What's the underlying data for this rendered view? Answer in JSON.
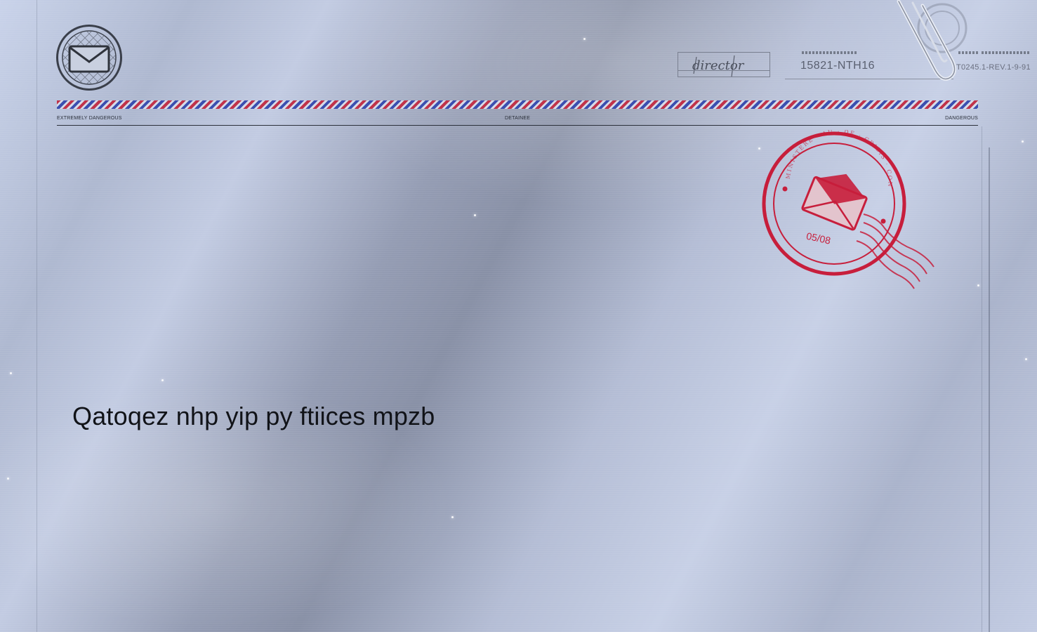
{
  "header": {
    "signature_text": "director",
    "code": "15821-NTH16",
    "reference": "T0245.1-REV.1-9-91"
  },
  "airmail_labels": {
    "left": "EXTREMELY DANGEROUS",
    "middle": "DETAINEE",
    "right": "DANGEROUS"
  },
  "stamp": {
    "date": "05/08",
    "color": "#c8102e"
  },
  "message": {
    "text": "Qatoqez nhp yip py ftiices mpzb"
  },
  "icons": {
    "emblem": "mail-icon",
    "stamp_icon": "envelope-icon",
    "clip": "paperclip-icon"
  }
}
